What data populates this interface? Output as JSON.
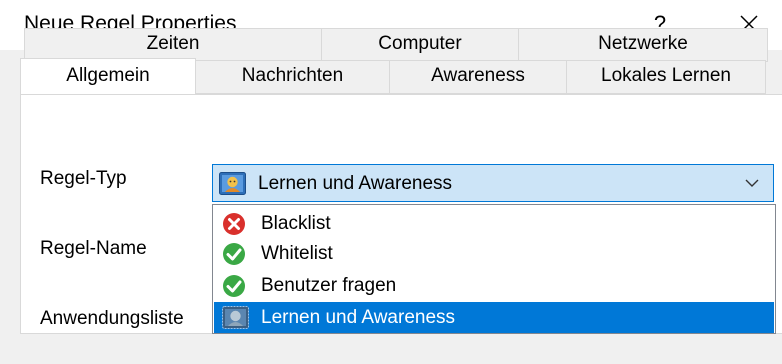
{
  "window": {
    "title": "Neue Regel Properties",
    "help_label": "?"
  },
  "tabs": {
    "row1": [
      {
        "label": "Zeiten"
      },
      {
        "label": "Computer"
      },
      {
        "label": "Netzwerke"
      }
    ],
    "row2": [
      {
        "label": "Allgemein"
      },
      {
        "label": "Nachrichten"
      },
      {
        "label": "Awareness"
      },
      {
        "label": "Lokales Lernen"
      }
    ],
    "active": "Allgemein"
  },
  "form": {
    "type_label": "Regel-Typ",
    "name_label": "Regel-Name",
    "list_label": "Anwendungsliste"
  },
  "combo": {
    "value": "Lernen und Awareness",
    "icon": "learn-awareness-icon",
    "options": [
      {
        "label": "Blacklist",
        "icon": "red-cross-icon"
      },
      {
        "label": "Whitelist",
        "icon": "green-check-icon"
      },
      {
        "label": "Benutzer fragen",
        "icon": "green-check-icon"
      },
      {
        "label": "Lernen und Awareness",
        "icon": "learn-awareness-icon",
        "selected": true
      }
    ]
  },
  "colors": {
    "accent": "#0078d7",
    "combo_bg": "#cce4f7",
    "dialog_bg": "#f0f0f0"
  }
}
